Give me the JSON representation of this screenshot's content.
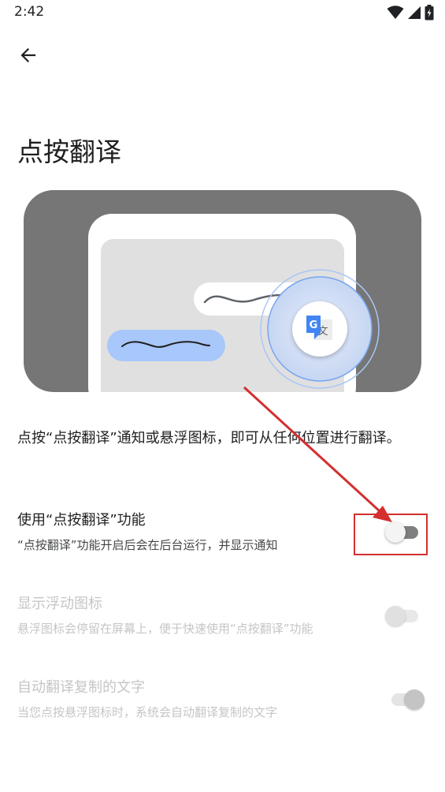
{
  "status_bar": {
    "time": "2:42"
  },
  "header": {
    "back_icon": "arrow-back-icon"
  },
  "page": {
    "title": "点按翻译",
    "description": "点按“点按翻译”通知或悬浮图标，即可从任何位置进行翻译。"
  },
  "settings": [
    {
      "title": "使用“点按翻译”功能",
      "subtitle": "“点按翻译”功能开启后会在后台运行，并显示通知",
      "enabled": true,
      "checked": false
    },
    {
      "title": "显示浮动图标",
      "subtitle": "悬浮图标会停留在屏幕上，便于快速使用“点按翻译”功能",
      "enabled": false,
      "checked": false
    },
    {
      "title": "自动翻译复制的文字",
      "subtitle": "当您点按悬浮图标时，系统会自动翻译复制的文字",
      "enabled": false,
      "checked": true
    }
  ],
  "colors": {
    "hero_background": "#757675",
    "bubble_blue": "#a8c7fa",
    "annotation_red": "#d32f2f",
    "translate_blue": "#4285f4"
  }
}
